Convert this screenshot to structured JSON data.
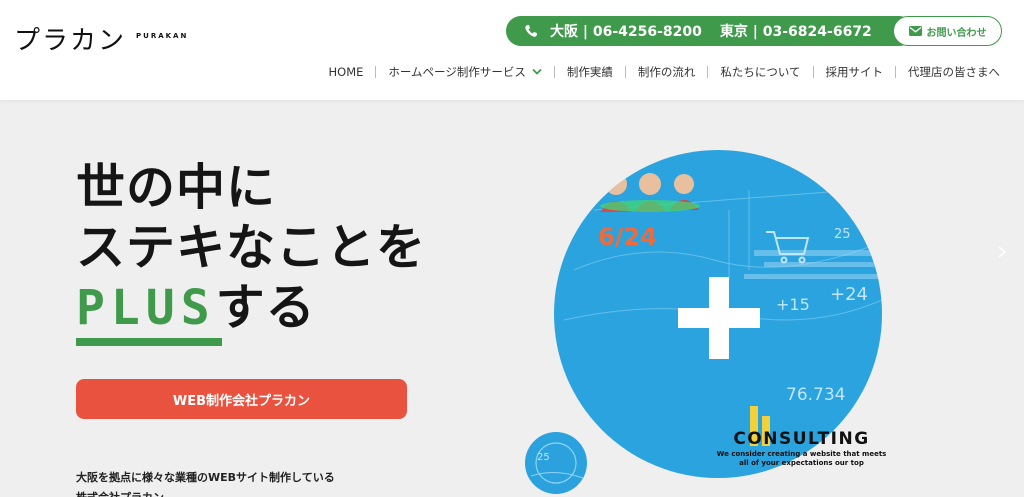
{
  "logo": {
    "text": "プラカン",
    "sub": "PURAKAN"
  },
  "header": {
    "phone_osaka": "大阪 | 06-4256-8200",
    "phone_tokyo": "東京 | 03-6824-6672",
    "contact_label": "お問い合わせ"
  },
  "nav": {
    "items": [
      {
        "label": "HOME"
      },
      {
        "label": "ホームページ制作サービス"
      },
      {
        "label": "制作実績"
      },
      {
        "label": "制作の流れ"
      },
      {
        "label": "私たちについて"
      },
      {
        "label": "採用サイト"
      },
      {
        "label": "代理店の皆さまへ"
      }
    ]
  },
  "hero": {
    "line1": "世の中に",
    "line2": "ステキなことを",
    "plus": "PLUS",
    "suffix": "する",
    "cta": "WEB制作会社プラカン",
    "desc_line1": "大阪を拠点に様々な業種のWEBサイト制作している",
    "desc_line2": "株式会社プラカン"
  },
  "visual": {
    "title": "CONSULTING",
    "sub1": "We consider creating a website that meets",
    "sub2": "all of your expectations our top",
    "deco_numbers": [
      "6/24",
      "+15",
      "+24",
      "25",
      "76.734",
      "25"
    ]
  },
  "colors": {
    "green": "#3f9a4b",
    "red": "#ea5240",
    "blue": "#2aa3df"
  },
  "icons": [
    "phone-icon",
    "mail-icon",
    "chevron-down-icon",
    "arrow-right-icon"
  ]
}
